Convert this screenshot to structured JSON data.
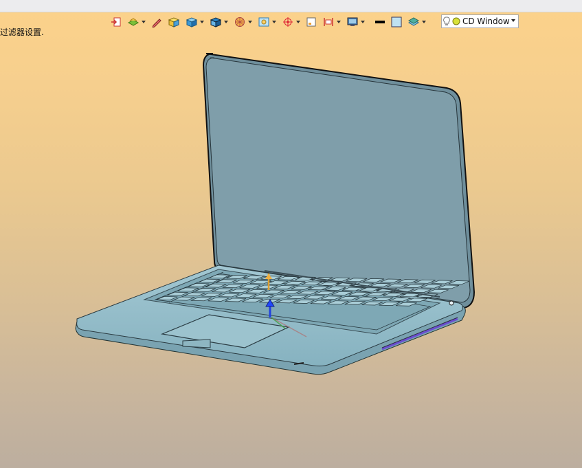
{
  "status": {
    "text": "过滤器设置."
  },
  "toolbar": {
    "items": [
      {
        "name": "import-icon"
      },
      {
        "name": "layer-icon",
        "dropdown": true
      },
      {
        "name": "pencil-icon"
      },
      {
        "name": "cube-yellow-icon"
      },
      {
        "name": "cube-blue-icon",
        "dropdown": true
      },
      {
        "name": "view-cube-icon",
        "dropdown": true
      },
      {
        "name": "sphere-icon",
        "dropdown": true
      },
      {
        "name": "frame-icon",
        "dropdown": true
      },
      {
        "name": "snap-target-icon",
        "dropdown": true
      },
      {
        "name": "page-icon"
      },
      {
        "name": "align-icon",
        "dropdown": true
      },
      {
        "name": "display-icon",
        "dropdown": true
      },
      {
        "name": "line-color-icon"
      },
      {
        "name": "fill-color-icon"
      },
      {
        "name": "layers-stack-icon",
        "dropdown": true
      }
    ]
  },
  "filter": {
    "label": "CD Window"
  },
  "colors": {
    "screen": "#7f9eaa",
    "body": "#8fb9c6",
    "accent": "#6a4fd0",
    "toolbar_bg": "#ececee"
  }
}
